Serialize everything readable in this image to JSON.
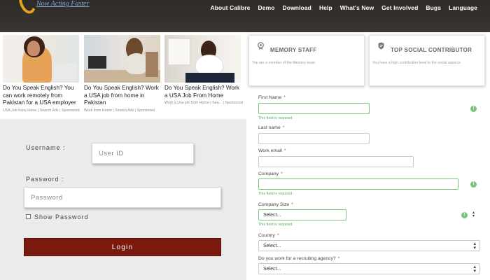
{
  "brand": {
    "tagline": "Now Acting Faster"
  },
  "nav": [
    "About Calibre",
    "Demo",
    "Download",
    "Help",
    "What's New",
    "Get Involved",
    "Bugs",
    "Language"
  ],
  "ads": [
    {
      "headline": "Do You Speak English? You can work remotely from Pakistan for a USA employer",
      "meta": "USA Job from Home | Search Ads | Sponsored"
    },
    {
      "headline": "Do You Speak English? Work a USA job from home in Pakistan",
      "meta": "Work from Home | Search Ads | Sponsored"
    },
    {
      "headline": "Do You Speak English? Work a USA Job From Home",
      "meta": "Work a Usa job from Home | Sea... | Sponsored"
    }
  ],
  "login": {
    "username_label": "Username :",
    "username_placeholder": "User ID",
    "password_label": "Password :",
    "password_placeholder": "Password",
    "show_password": "Show Password",
    "login_button": "Login"
  },
  "badges": [
    {
      "title": "MEMORY STAFF",
      "description": "You are a member of the Memory team",
      "icon": "badge-icon"
    },
    {
      "title": "TOP SOCIAL CONTRIBUTOR",
      "description": "You have a high contribution level to the social aspects",
      "icon": "shield-check-icon"
    }
  ],
  "form": {
    "first_name_label": "First Name",
    "last_name_label": "Last name",
    "work_email_label": "Work email",
    "company_label": "Company",
    "company_size_label": "Company Size",
    "country_label": "Country",
    "agency_label": "Do you work for a recruiting agency?",
    "required_marker": "*",
    "error_text": "This field is required.",
    "select_placeholder": "Select...",
    "error_dot": "!"
  },
  "colors": {
    "nav_bg": "#2e2a27",
    "login_btn": "#7a1a0f",
    "error_green": "#7bc47f",
    "brand_orange": "#e3a21a"
  }
}
